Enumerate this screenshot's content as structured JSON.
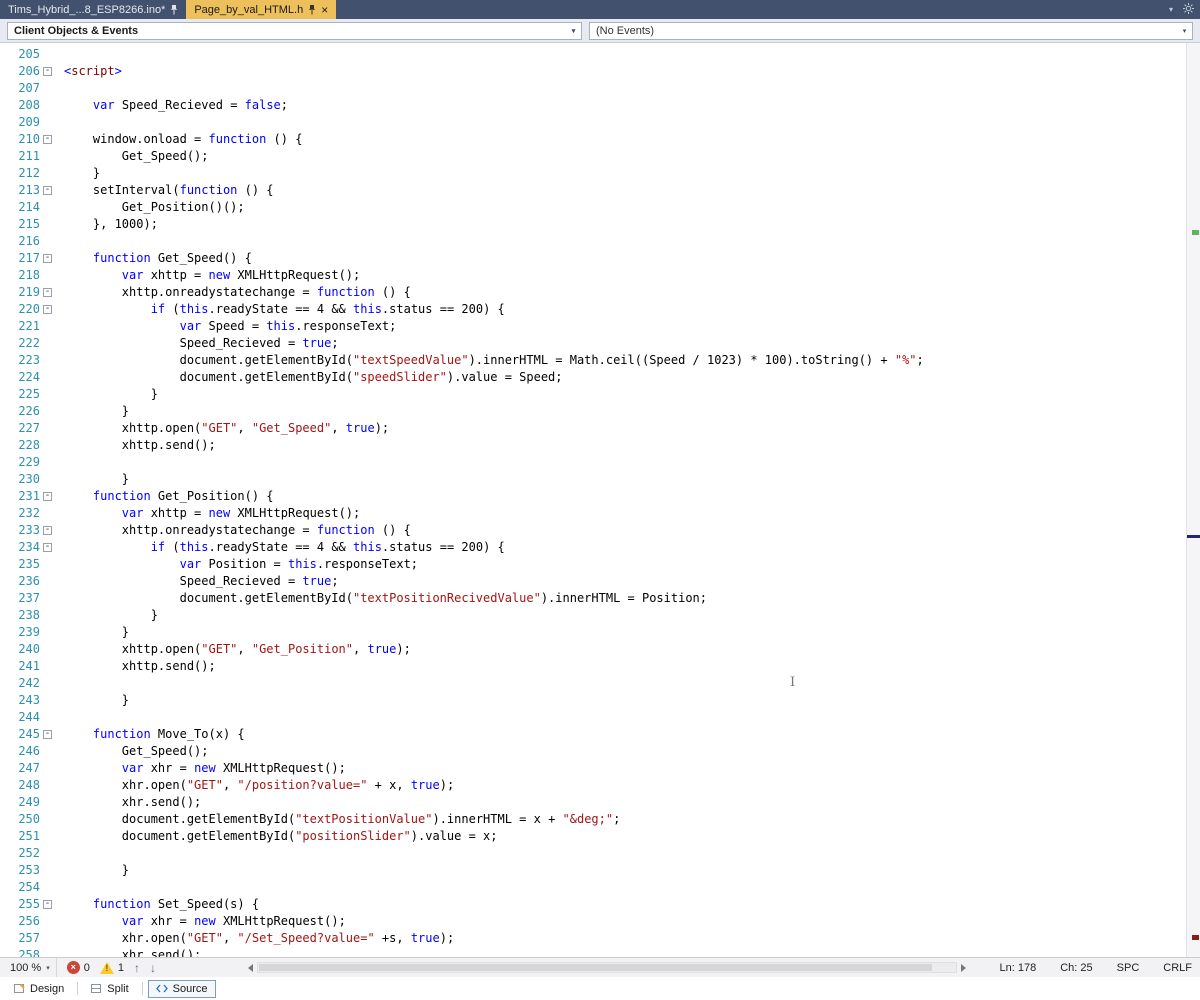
{
  "tab_bar": {
    "tabs": [
      {
        "label": "Tims_Hybrid_...8_ESP8266.ino*",
        "state": "inactive"
      },
      {
        "label": "Page_by_val_HTML.h",
        "state": "active"
      }
    ]
  },
  "navigation_bar": {
    "scope_dropdown": "Client Objects & Events",
    "event_dropdown": "(No Events)"
  },
  "status_bar": {
    "zoom": "100 %",
    "error_count": "0",
    "warning_count": "1",
    "line": "Ln: 178",
    "column": "Ch: 25",
    "insert_mode": "SPC",
    "line_ending": "CRLF"
  },
  "view_bar": {
    "items": [
      {
        "label": "Design"
      },
      {
        "label": "Split"
      },
      {
        "label": "Source"
      }
    ],
    "active": "Source"
  },
  "icons": {
    "close": "×",
    "chevron_down": "▾",
    "up": "↑",
    "down": "↓",
    "fold_minus": "-",
    "ibeam": "I"
  },
  "colors": {
    "tab_bar_bg": "#42526e",
    "active_tab": "#edc05b",
    "keyword": "#0000ff",
    "string": "#a31515",
    "tag": "#800000",
    "line_number": "#2b91af",
    "error_red": "#cb4539",
    "warning_yellow": "#fcc92b",
    "marker_green": "#5bb75b",
    "marker_navy": "#23236e",
    "marker_maroon": "#8b1b1b"
  },
  "editor": {
    "scroll_markers": [
      {
        "name": "scrollbar-change-marker-green",
        "color": "#5bb75b",
        "top_pct": 20.5,
        "height": 5,
        "full": false
      },
      {
        "name": "scrollbar-caret-marker-navy",
        "color": "#23236e",
        "top_pct": 53.8,
        "height": 3,
        "full": true
      },
      {
        "name": "scrollbar-marker-maroon",
        "color": "#8b1b1b",
        "top_pct": 97.6,
        "height": 5,
        "full": false
      }
    ],
    "lines": [
      {
        "n": 205,
        "f": 0,
        "t": []
      },
      {
        "n": 206,
        "f": 1,
        "t": [
          [
            "b",
            "<"
          ],
          [
            "t",
            "script"
          ],
          [
            "b",
            ">"
          ]
        ]
      },
      {
        "n": 207,
        "f": 0,
        "t": []
      },
      {
        "n": 208,
        "f": 0,
        "t": [
          [
            "p",
            "    "
          ],
          [
            "k",
            "var"
          ],
          [
            "p",
            " Speed_Recieved = "
          ],
          [
            "k",
            "false"
          ],
          [
            "p",
            ";"
          ]
        ]
      },
      {
        "n": 209,
        "f": 0,
        "t": []
      },
      {
        "n": 210,
        "f": 1,
        "t": [
          [
            "p",
            "    window.onload = "
          ],
          [
            "k",
            "function"
          ],
          [
            "p",
            " () {"
          ]
        ]
      },
      {
        "n": 211,
        "f": 0,
        "t": [
          [
            "p",
            "        Get_Speed();"
          ]
        ]
      },
      {
        "n": 212,
        "f": 0,
        "t": [
          [
            "p",
            "    }"
          ]
        ]
      },
      {
        "n": 213,
        "f": 1,
        "t": [
          [
            "p",
            "    setInterval("
          ],
          [
            "k",
            "function"
          ],
          [
            "p",
            " () {"
          ]
        ]
      },
      {
        "n": 214,
        "f": 0,
        "t": [
          [
            "p",
            "        Get_Position()();"
          ]
        ]
      },
      {
        "n": 215,
        "f": 0,
        "t": [
          [
            "p",
            "    }, 1000);"
          ]
        ]
      },
      {
        "n": 216,
        "f": 0,
        "t": []
      },
      {
        "n": 217,
        "f": 1,
        "t": [
          [
            "p",
            "    "
          ],
          [
            "k",
            "function"
          ],
          [
            "p",
            " Get_Speed() {"
          ]
        ]
      },
      {
        "n": 218,
        "f": 0,
        "t": [
          [
            "p",
            "        "
          ],
          [
            "k",
            "var"
          ],
          [
            "p",
            " xhttp = "
          ],
          [
            "k",
            "new"
          ],
          [
            "p",
            " XMLHttpRequest();"
          ]
        ]
      },
      {
        "n": 219,
        "f": 1,
        "t": [
          [
            "p",
            "        xhttp.onreadystatechange = "
          ],
          [
            "k",
            "function"
          ],
          [
            "p",
            " () {"
          ]
        ]
      },
      {
        "n": 220,
        "f": 1,
        "t": [
          [
            "p",
            "            "
          ],
          [
            "k",
            "if"
          ],
          [
            "p",
            " ("
          ],
          [
            "k",
            "this"
          ],
          [
            "p",
            ".readyState == 4 && "
          ],
          [
            "k",
            "this"
          ],
          [
            "p",
            ".status == 200) {"
          ]
        ]
      },
      {
        "n": 221,
        "f": 0,
        "t": [
          [
            "p",
            "                "
          ],
          [
            "k",
            "var"
          ],
          [
            "p",
            " Speed = "
          ],
          [
            "k",
            "this"
          ],
          [
            "p",
            ".responseText;"
          ]
        ]
      },
      {
        "n": 222,
        "f": 0,
        "t": [
          [
            "p",
            "                Speed_Recieved = "
          ],
          [
            "k",
            "true"
          ],
          [
            "p",
            ";"
          ]
        ]
      },
      {
        "n": 223,
        "f": 0,
        "t": [
          [
            "p",
            "                document.getElementById("
          ],
          [
            "s",
            "\"textSpeedValue\""
          ],
          [
            "p",
            ").innerHTML = Math.ceil((Speed / 1023) * 100).toString() + "
          ],
          [
            "s",
            "\"%\""
          ],
          [
            "p",
            ";"
          ]
        ]
      },
      {
        "n": 224,
        "f": 0,
        "t": [
          [
            "p",
            "                document.getElementById("
          ],
          [
            "s",
            "\"speedSlider\""
          ],
          [
            "p",
            ").value = Speed;"
          ]
        ]
      },
      {
        "n": 225,
        "f": 0,
        "t": [
          [
            "p",
            "            }"
          ]
        ]
      },
      {
        "n": 226,
        "f": 0,
        "t": [
          [
            "p",
            "        }"
          ]
        ]
      },
      {
        "n": 227,
        "f": 0,
        "t": [
          [
            "p",
            "        xhttp.open("
          ],
          [
            "s",
            "\"GET\""
          ],
          [
            "p",
            ", "
          ],
          [
            "s",
            "\"Get_Speed\""
          ],
          [
            "p",
            ", "
          ],
          [
            "k",
            "true"
          ],
          [
            "p",
            ");"
          ]
        ]
      },
      {
        "n": 228,
        "f": 0,
        "t": [
          [
            "p",
            "        xhttp.send();"
          ]
        ]
      },
      {
        "n": 229,
        "f": 0,
        "t": []
      },
      {
        "n": 230,
        "f": 0,
        "t": [
          [
            "p",
            "        }"
          ]
        ]
      },
      {
        "n": 231,
        "f": 1,
        "t": [
          [
            "p",
            "    "
          ],
          [
            "k",
            "function"
          ],
          [
            "p",
            " Get_Position() {"
          ]
        ]
      },
      {
        "n": 232,
        "f": 0,
        "t": [
          [
            "p",
            "        "
          ],
          [
            "k",
            "var"
          ],
          [
            "p",
            " xhttp = "
          ],
          [
            "k",
            "new"
          ],
          [
            "p",
            " XMLHttpRequest();"
          ]
        ]
      },
      {
        "n": 233,
        "f": 1,
        "t": [
          [
            "p",
            "        xhttp.onreadystatechange = "
          ],
          [
            "k",
            "function"
          ],
          [
            "p",
            " () {"
          ]
        ]
      },
      {
        "n": 234,
        "f": 1,
        "t": [
          [
            "p",
            "            "
          ],
          [
            "k",
            "if"
          ],
          [
            "p",
            " ("
          ],
          [
            "k",
            "this"
          ],
          [
            "p",
            ".readyState == 4 && "
          ],
          [
            "k",
            "this"
          ],
          [
            "p",
            ".status == 200) {"
          ]
        ]
      },
      {
        "n": 235,
        "f": 0,
        "t": [
          [
            "p",
            "                "
          ],
          [
            "k",
            "var"
          ],
          [
            "p",
            " Position = "
          ],
          [
            "k",
            "this"
          ],
          [
            "p",
            ".responseText;"
          ]
        ]
      },
      {
        "n": 236,
        "f": 0,
        "t": [
          [
            "p",
            "                Speed_Recieved = "
          ],
          [
            "k",
            "true"
          ],
          [
            "p",
            ";"
          ]
        ]
      },
      {
        "n": 237,
        "f": 0,
        "t": [
          [
            "p",
            "                document.getElementById("
          ],
          [
            "s",
            "\"textPositionRecivedValue\""
          ],
          [
            "p",
            ").innerHTML = Position;"
          ]
        ]
      },
      {
        "n": 238,
        "f": 0,
        "t": [
          [
            "p",
            "            }"
          ]
        ]
      },
      {
        "n": 239,
        "f": 0,
        "t": [
          [
            "p",
            "        }"
          ]
        ]
      },
      {
        "n": 240,
        "f": 0,
        "t": [
          [
            "p",
            "        xhttp.open("
          ],
          [
            "s",
            "\"GET\""
          ],
          [
            "p",
            ", "
          ],
          [
            "s",
            "\"Get_Position\""
          ],
          [
            "p",
            ", "
          ],
          [
            "k",
            "true"
          ],
          [
            "p",
            ");"
          ]
        ]
      },
      {
        "n": 241,
        "f": 0,
        "t": [
          [
            "p",
            "        xhttp.send();"
          ]
        ]
      },
      {
        "n": 242,
        "f": 0,
        "t": []
      },
      {
        "n": 243,
        "f": 0,
        "t": [
          [
            "p",
            "        }"
          ]
        ]
      },
      {
        "n": 244,
        "f": 0,
        "t": []
      },
      {
        "n": 245,
        "f": 1,
        "t": [
          [
            "p",
            "    "
          ],
          [
            "k",
            "function"
          ],
          [
            "p",
            " Move_To(x) {"
          ]
        ]
      },
      {
        "n": 246,
        "f": 0,
        "t": [
          [
            "p",
            "        Get_Speed();"
          ]
        ]
      },
      {
        "n": 247,
        "f": 0,
        "t": [
          [
            "p",
            "        "
          ],
          [
            "k",
            "var"
          ],
          [
            "p",
            " xhr = "
          ],
          [
            "k",
            "new"
          ],
          [
            "p",
            " XMLHttpRequest();"
          ]
        ]
      },
      {
        "n": 248,
        "f": 0,
        "t": [
          [
            "p",
            "        xhr.open("
          ],
          [
            "s",
            "\"GET\""
          ],
          [
            "p",
            ", "
          ],
          [
            "s",
            "\"/position?value=\""
          ],
          [
            "p",
            " + x, "
          ],
          [
            "k",
            "true"
          ],
          [
            "p",
            ");"
          ]
        ]
      },
      {
        "n": 249,
        "f": 0,
        "t": [
          [
            "p",
            "        xhr.send();"
          ]
        ]
      },
      {
        "n": 250,
        "f": 0,
        "t": [
          [
            "p",
            "        document.getElementById("
          ],
          [
            "s",
            "\"textPositionValue\""
          ],
          [
            "p",
            ").innerHTML = x + "
          ],
          [
            "s",
            "\"&deg;\""
          ],
          [
            "p",
            ";"
          ]
        ]
      },
      {
        "n": 251,
        "f": 0,
        "t": [
          [
            "p",
            "        document.getElementById("
          ],
          [
            "s",
            "\"positionSlider\""
          ],
          [
            "p",
            ").value = x;"
          ]
        ]
      },
      {
        "n": 252,
        "f": 0,
        "t": []
      },
      {
        "n": 253,
        "f": 0,
        "t": [
          [
            "p",
            "        }"
          ]
        ]
      },
      {
        "n": 254,
        "f": 0,
        "t": []
      },
      {
        "n": 255,
        "f": 1,
        "t": [
          [
            "p",
            "    "
          ],
          [
            "k",
            "function"
          ],
          [
            "p",
            " Set_Speed(s) {"
          ]
        ]
      },
      {
        "n": 256,
        "f": 0,
        "t": [
          [
            "p",
            "        "
          ],
          [
            "k",
            "var"
          ],
          [
            "p",
            " xhr = "
          ],
          [
            "k",
            "new"
          ],
          [
            "p",
            " XMLHttpRequest();"
          ]
        ]
      },
      {
        "n": 257,
        "f": 0,
        "t": [
          [
            "p",
            "        xhr.open("
          ],
          [
            "s",
            "\"GET\""
          ],
          [
            "p",
            ", "
          ],
          [
            "s",
            "\"/Set_Speed?value=\""
          ],
          [
            "p",
            " +s, "
          ],
          [
            "k",
            "true"
          ],
          [
            "p",
            ");"
          ]
        ]
      },
      {
        "n": 258,
        "f": 0,
        "t": [
          [
            "p",
            "        xhr.send();"
          ]
        ]
      }
    ]
  }
}
